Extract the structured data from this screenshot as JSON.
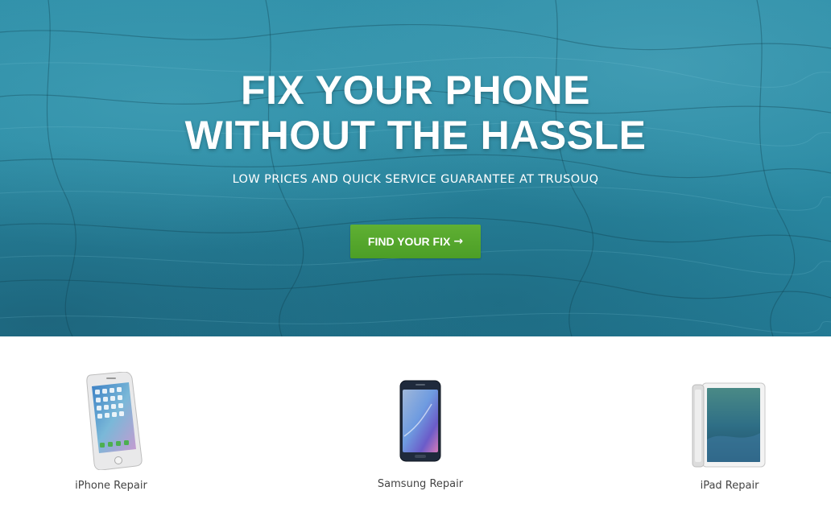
{
  "hero": {
    "title_line1": "FIX YOUR PHONE",
    "title_line2": "WITHOUT THE HASSLE",
    "subtitle": "LOW PRICES AND QUICK SERVICE GUARANTEE AT TRUSOUQ",
    "cta_label": "FIND YOUR FIX",
    "cta_arrow": "→"
  },
  "devices": [
    {
      "label": "iPhone Repair",
      "icon": "iphone-icon"
    },
    {
      "label": "Samsung Repair",
      "icon": "samsung-phone-icon"
    },
    {
      "label": "iPad Repair",
      "icon": "ipad-icon"
    }
  ],
  "colors": {
    "hero_background": "#2b8ba4",
    "cta_background": "#55a62c",
    "label_text": "#444444"
  }
}
